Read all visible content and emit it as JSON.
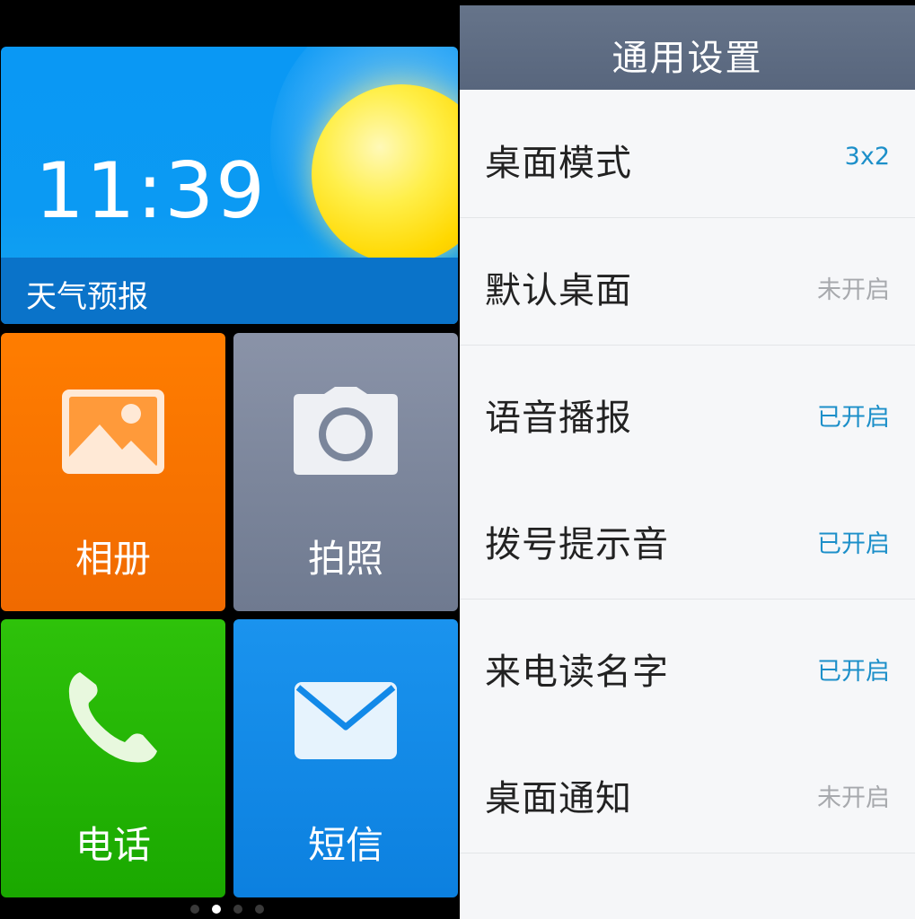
{
  "launcher": {
    "weather": {
      "time": "11:39",
      "label": "天气预报"
    },
    "tiles": [
      {
        "id": "album",
        "label": "相册",
        "icon": "picture-icon"
      },
      {
        "id": "camera",
        "label": "拍照",
        "icon": "camera-icon"
      },
      {
        "id": "phone",
        "label": "电话",
        "icon": "phone-icon"
      },
      {
        "id": "sms",
        "label": "短信",
        "icon": "envelope-icon"
      }
    ],
    "page_indicator": {
      "count": 4,
      "active": 2
    },
    "colors": {
      "album": "#f57300",
      "camera": "#7b869b",
      "phone": "#22b505",
      "sms": "#1289e8",
      "weather": "#0a98f4"
    }
  },
  "settings": {
    "title": "通用设置",
    "rows": [
      {
        "name": "桌面模式",
        "value": "3x2"
      },
      {
        "name": "默认桌面",
        "value": "未开启"
      },
      {
        "name": "语音播报",
        "value": "已开启"
      },
      {
        "name": "拨号提示音",
        "value": "已开启"
      },
      {
        "name": "来电读名字",
        "value": "已开启"
      },
      {
        "name": "桌面通知",
        "value": "未开启"
      }
    ],
    "colors": {
      "header": "#5e6c83",
      "on": "#1c8fc9",
      "off": "#a7a9ad"
    }
  }
}
